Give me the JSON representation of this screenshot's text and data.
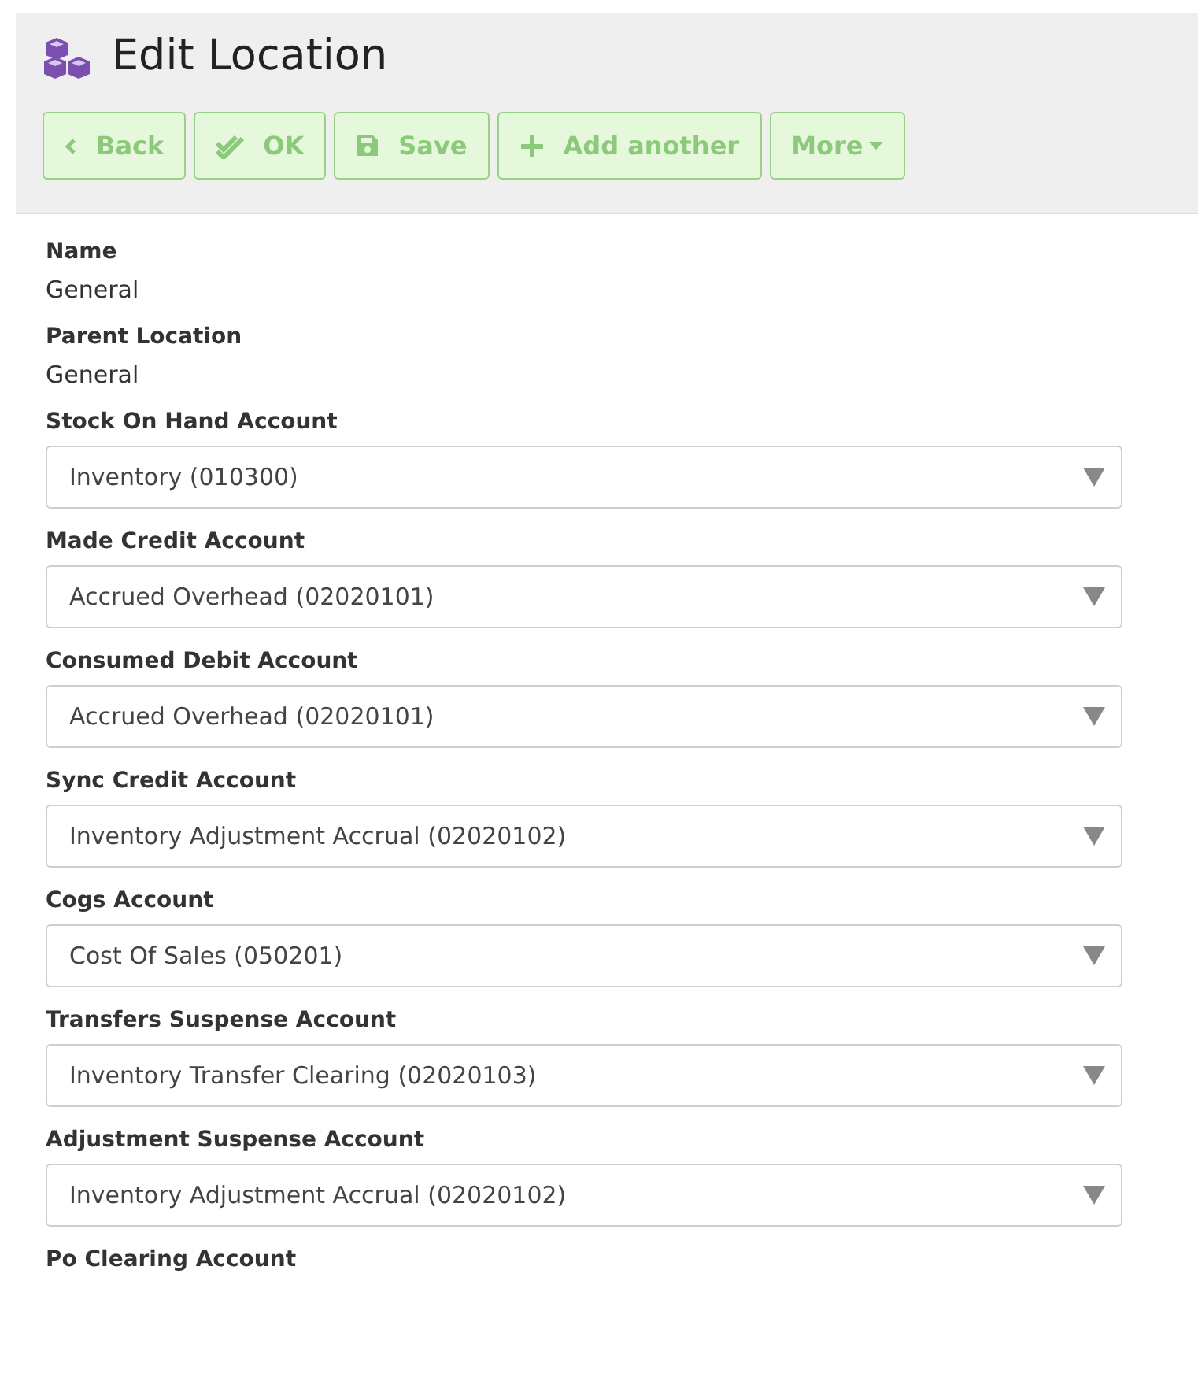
{
  "header": {
    "title": "Edit Location"
  },
  "buttons": [
    {
      "label": "Back",
      "kind": "back"
    },
    {
      "label": "OK",
      "kind": "ok"
    },
    {
      "label": "Save",
      "kind": "save"
    },
    {
      "label": "Add another",
      "kind": "add"
    },
    {
      "label": "More",
      "kind": "dropdown"
    }
  ],
  "fields": [
    {
      "kind": "text",
      "label": "Name",
      "value": "General"
    },
    {
      "kind": "text",
      "label": "Parent Location",
      "value": "General"
    },
    {
      "kind": "select",
      "label": "Stock On Hand Account",
      "value": "Inventory (010300)"
    },
    {
      "kind": "select",
      "label": "Made Credit Account",
      "value": "Accrued Overhead (02020101)"
    },
    {
      "kind": "select",
      "label": "Consumed Debit Account",
      "value": "Accrued Overhead (02020101)"
    },
    {
      "kind": "select",
      "label": "Sync Credit Account",
      "value": "Inventory Adjustment Accrual (02020102)"
    },
    {
      "kind": "select",
      "label": "Cogs Account",
      "value": "Cost Of Sales (050201)"
    },
    {
      "kind": "select",
      "label": "Transfers Suspense Account",
      "value": "Inventory Transfer Clearing (02020103)"
    },
    {
      "kind": "select",
      "label": "Adjustment Suspense Account",
      "value": "Inventory Adjustment Accrual (02020102)"
    },
    {
      "kind": "label",
      "label": "Po Clearing Account"
    }
  ]
}
